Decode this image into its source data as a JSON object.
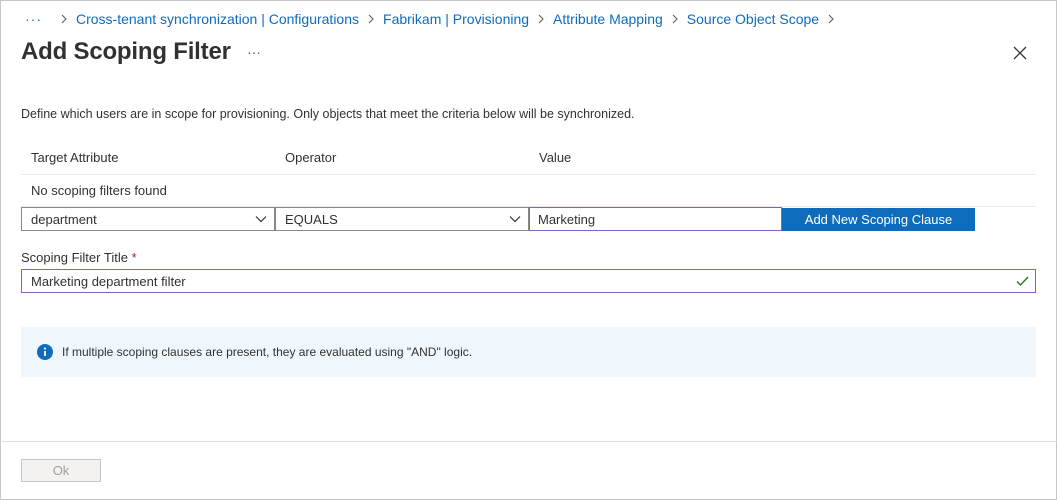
{
  "breadcrumb": {
    "ellipsis": "···",
    "items": [
      "Cross-tenant synchronization | Configurations",
      "Fabrikam | Provisioning",
      "Attribute Mapping",
      "Source Object Scope"
    ]
  },
  "header": {
    "title": "Add Scoping Filter",
    "more": "···"
  },
  "description": "Define which users are in scope for provisioning. Only objects that meet the criteria below will be synchronized.",
  "table": {
    "columns": [
      "Target Attribute",
      "Operator",
      "Value"
    ],
    "empty_message": "No scoping filters found"
  },
  "clause": {
    "attribute": "department",
    "operator": "EQUALS",
    "value": "Marketing",
    "add_button": "Add New Scoping Clause"
  },
  "filter_title": {
    "label": "Scoping Filter Title",
    "required_mark": "*",
    "value": "Marketing department filter"
  },
  "info": {
    "text": "If multiple scoping clauses are present, they are evaluated using \"AND\" logic."
  },
  "footer": {
    "ok_label": "Ok"
  },
  "colors": {
    "accent": "#0f6cbd",
    "focus_border": "#8661c5",
    "info_bg": "#eff6fc",
    "check": "#107c10"
  }
}
